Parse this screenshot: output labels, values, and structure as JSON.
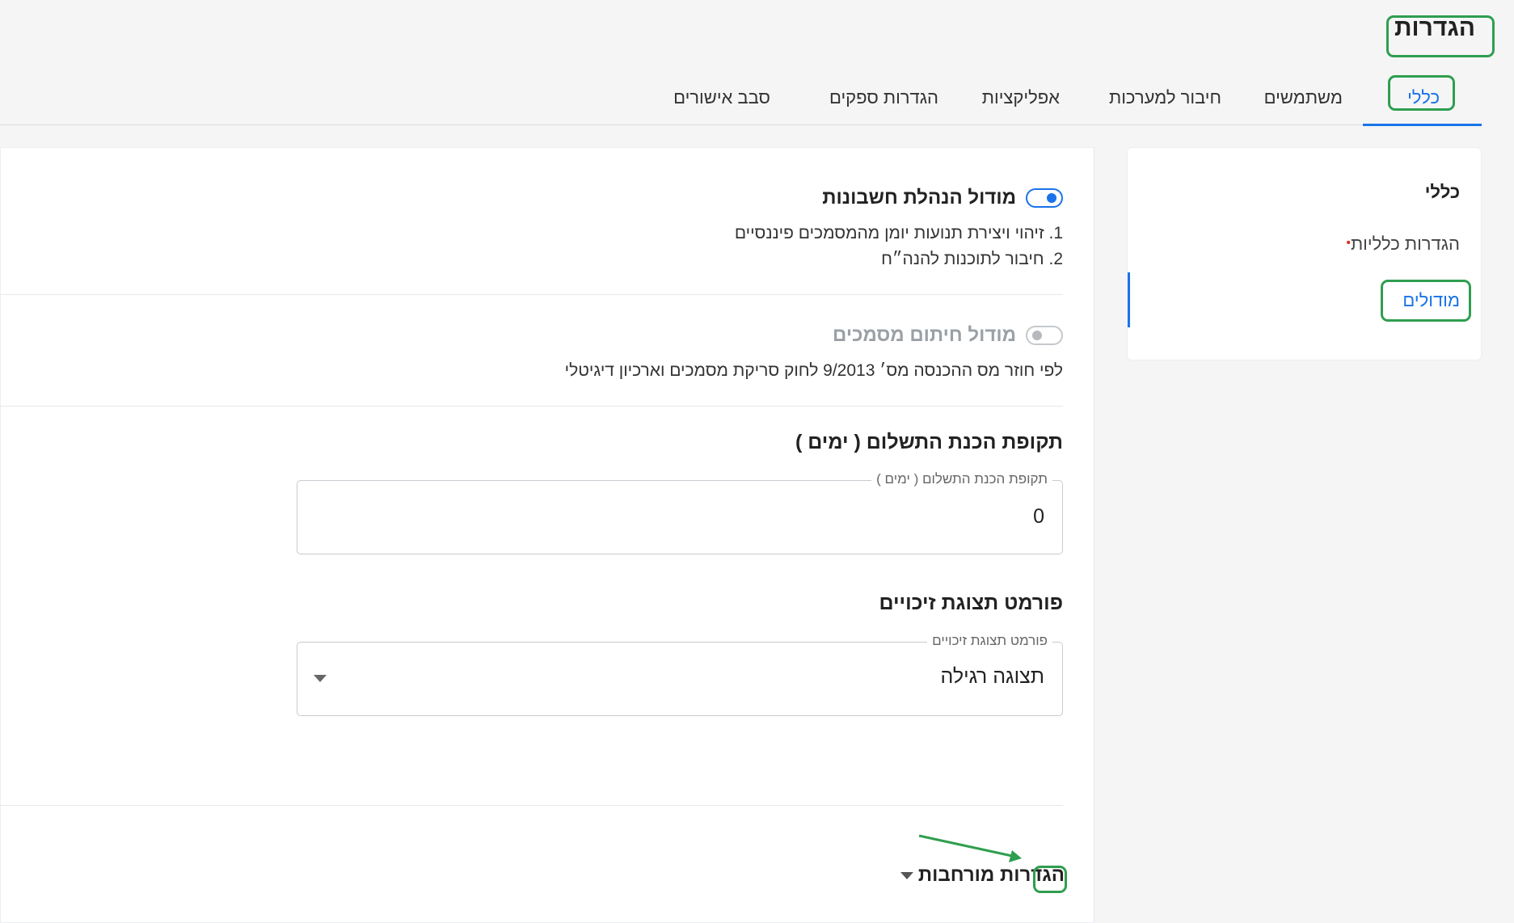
{
  "header": {
    "title": "הגדרות"
  },
  "tabs": [
    {
      "label": "כללי",
      "active": true
    },
    {
      "label": "משתמשים"
    },
    {
      "label": "חיבור למערכות"
    },
    {
      "label": "אפליקציות"
    },
    {
      "label": "הגדרות ספקים"
    },
    {
      "label": "סבב אישורים"
    }
  ],
  "sidebar": {
    "heading": "כללי",
    "items": [
      {
        "label": "הגדרות כלליות",
        "required_marker": "•"
      },
      {
        "label": "מודולים",
        "active": true
      }
    ]
  },
  "main": {
    "accounting_module": {
      "title": "מודול הנהלת חשבונות",
      "enabled": true,
      "lines": [
        "1. זיהוי ויצירת תנועות יומן מהמסמכים פיננסיים",
        "2. חיבור לתוכנות להנה״ח"
      ]
    },
    "signing_module": {
      "title": "מודול חיתום מסמכים",
      "enabled": false,
      "description": "לפי חוזר מס ההכנסה מס׳ 9/2013 לחוק סריקת מסמכים וארכיון דיגיטלי"
    },
    "payment_period": {
      "section_title": "תקופת הכנת התשלום ( ימים )",
      "field_label": "תקופת הכנת התשלום ( ימים )",
      "value": "0"
    },
    "credit_format": {
      "section_title": "פורמט תצוגת זיכויים",
      "field_label": "פורמט תצוגת זיכויים",
      "selected": "תצוגה רגילה"
    },
    "advanced": {
      "label": "הגדרות מורחבות"
    }
  },
  "colors": {
    "accent": "#1a73e8",
    "highlight": "#2f9e4f",
    "required": "#d93025"
  }
}
